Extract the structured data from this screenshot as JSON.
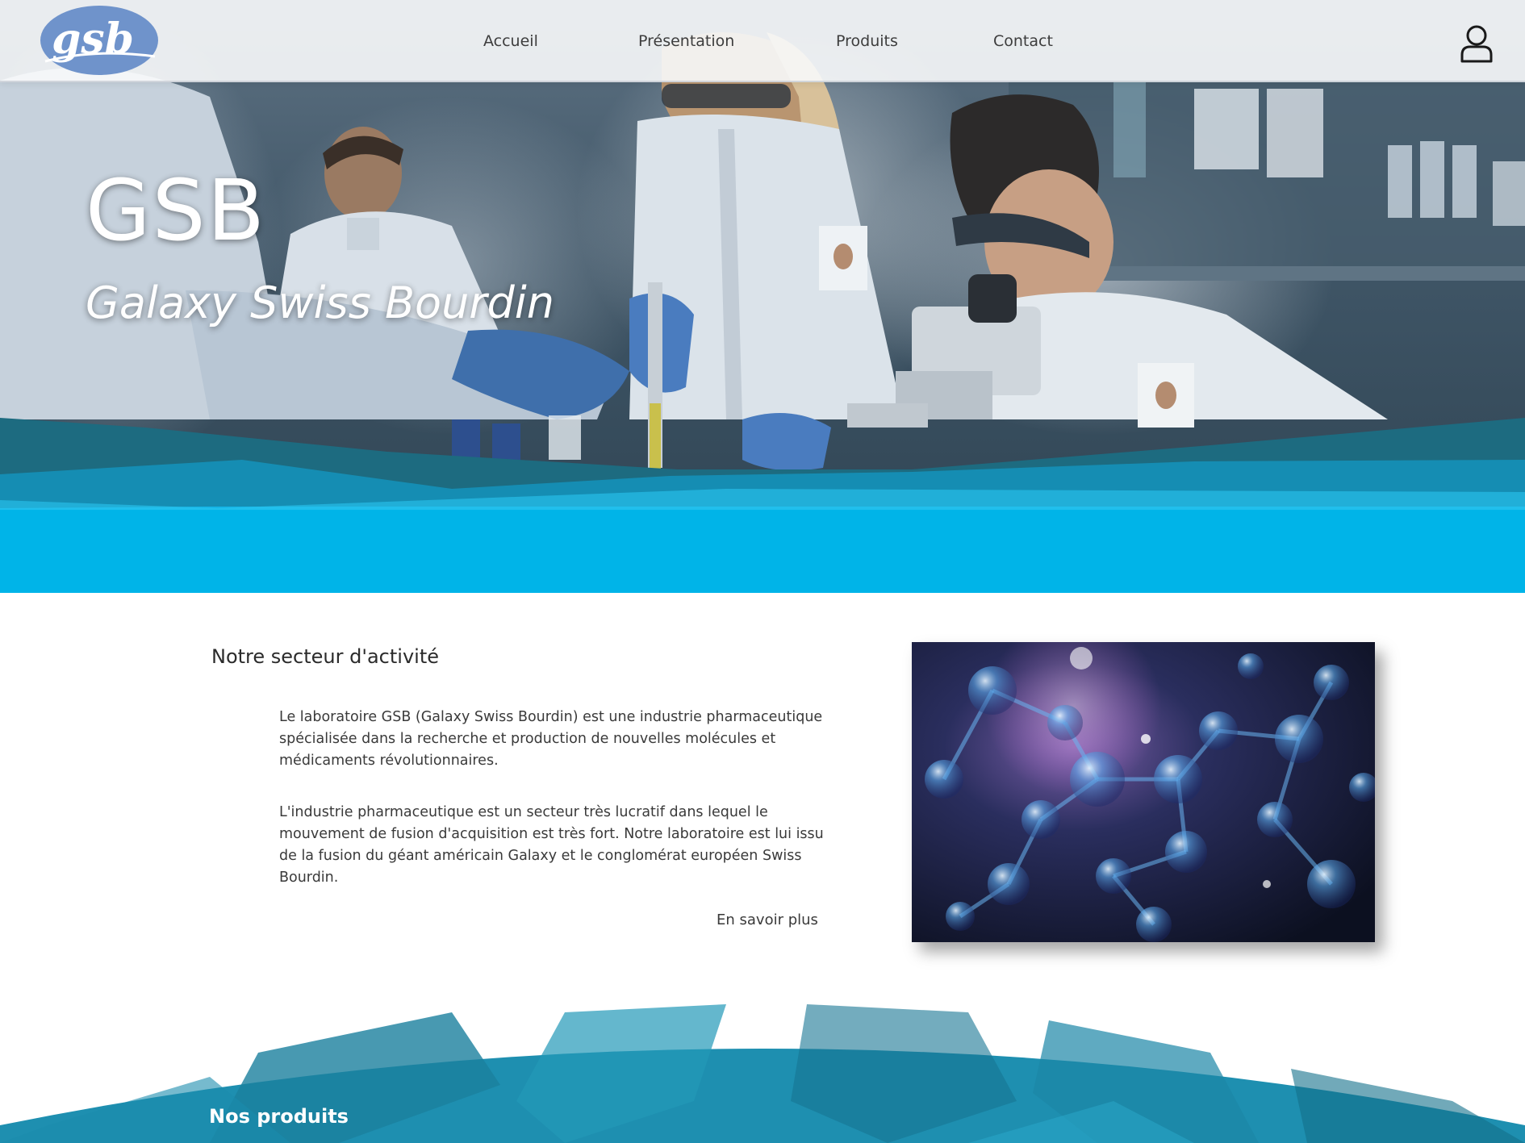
{
  "nav": {
    "logo_text": "gsb",
    "links": [
      {
        "label": "Accueil"
      },
      {
        "label": "Présentation"
      },
      {
        "label": "Produits"
      },
      {
        "label": "Contact"
      }
    ],
    "user_icon": "user-icon"
  },
  "hero": {
    "title": "GSB",
    "subtitle": "Galaxy Swiss Bourdin"
  },
  "activity": {
    "title": "Notre secteur d'activité",
    "paragraph_1": "Le laboratoire GSB (Galaxy Swiss Bourdin) est une industrie pharmaceutique spécialisée dans la recherche et production de nouvelles molécules et médicaments révolutionnaires.",
    "paragraph_2": "L'industrie pharmaceutique est un secteur très lucratif dans lequel le mouvement de fusion d'acquisition est très fort. Notre laboratoire est lui issu de la fusion du géant américain Galaxy et le conglomérat européen Swiss Bourdin.",
    "read_more": "En savoir plus"
  },
  "products": {
    "title": "Nos produits"
  },
  "colors": {
    "wave_dark": "#1d6b80",
    "wave_light": "#13b8e8",
    "logo_blue": "#6f93cb",
    "products_teal": "#1e8fb0"
  }
}
